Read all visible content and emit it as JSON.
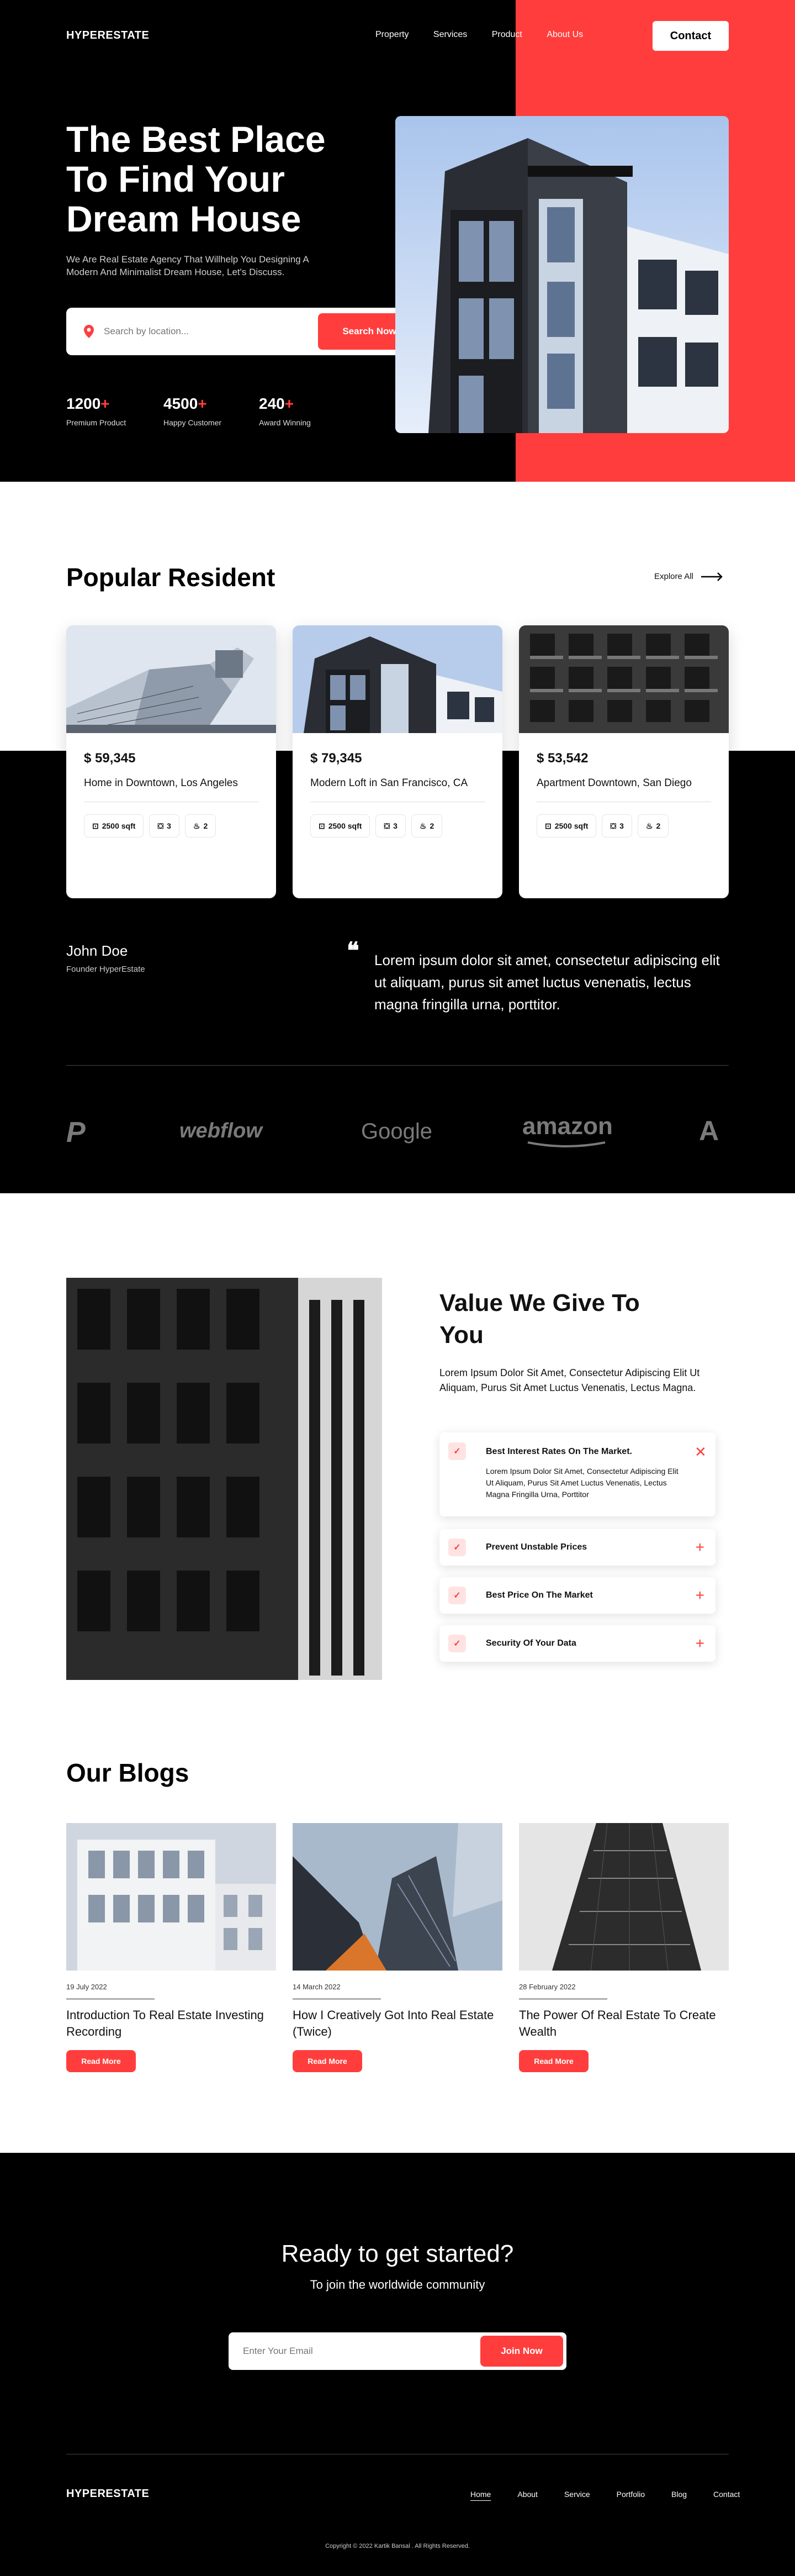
{
  "header": {
    "logo": "HYPERESTATE",
    "nav": [
      "Property",
      "Services",
      "Product",
      "About Us"
    ],
    "contact": "Contact"
  },
  "hero": {
    "title": "The Best Place To Find Your Dream House",
    "subtitle": "We Are  Real Estate Agency That Willhelp You Designing A Modern And Minimalist Dream House, Let's Discuss.",
    "search_placeholder": "Search by location...",
    "search_button": "Search Now",
    "stats": [
      {
        "value": "1200",
        "suffix": "+",
        "label": "Premium Product"
      },
      {
        "value": "4500",
        "suffix": "+",
        "label": "Happy Customer"
      },
      {
        "value": "240",
        "suffix": "+",
        "label": "Award Winning"
      }
    ]
  },
  "popular": {
    "title": "Popular Resident",
    "explore": "Explore All",
    "cards": [
      {
        "price": "$ 59,345",
        "name": "Home in Downtown, Los Angeles",
        "sqft": "2500 sqft",
        "beds": "3",
        "baths": "2"
      },
      {
        "price": "$ 79,345",
        "name": "Modern Loft in San Francisco, CA",
        "sqft": "2500 sqft",
        "beds": "3",
        "baths": "2"
      },
      {
        "price": "$ 53,542",
        "name": "Apartment Downtown, San Diego",
        "sqft": "2500 sqft",
        "beds": "3",
        "baths": "2"
      }
    ]
  },
  "testimonial": {
    "name": "John Doe",
    "role": "Founder HyperEstate",
    "quote": "Lorem ipsum dolor sit amet, consectetur adipiscing elit ut aliquam, purus sit amet luctus venenatis, lectus magna fringilla urna, porttitor."
  },
  "brands": [
    "P",
    "webflow",
    "Google",
    "amazon",
    "A"
  ],
  "value": {
    "title": "Value We Give To You",
    "desc": "Lorem Ipsum Dolor Sit Amet, Consectetur Adipiscing Elit Ut Aliquam, Purus Sit Amet Luctus Venenatis, Lectus Magna.",
    "items": [
      {
        "title": "Best Interest Rates On The Market.",
        "body": "Lorem Ipsum Dolor Sit Amet, Consectetur Adipiscing Elit Ut Aliquam, Purus Sit Amet Luctus Venenatis, Lectus Magna Fringilla Urna, Porttitor",
        "open": true
      },
      {
        "title": "Prevent Unstable Prices",
        "open": false
      },
      {
        "title": "Best Price On The Market",
        "open": false
      },
      {
        "title": "Security Of Your Data",
        "open": false
      }
    ]
  },
  "blogs": {
    "title": "Our Blogs",
    "read_more": "Read More",
    "posts": [
      {
        "date": "19 July 2022",
        "title": "Introduction To Real Estate Investing Recording"
      },
      {
        "date": "14 March 2022",
        "title": "How I Creatively Got Into Real Estate (Twice)"
      },
      {
        "date": "28 February 2022",
        "title": "The Power Of Real Estate To Create Wealth"
      }
    ]
  },
  "cta": {
    "title": "Ready to get started?",
    "subtitle": "To join the worldwide community",
    "email_placeholder": "Enter Your Email",
    "button": "Join Now"
  },
  "footer": {
    "logo": "HYPERESTATE",
    "nav": [
      "Home",
      "About",
      "Service",
      "Portfolio",
      "Blog",
      "Contact"
    ],
    "copyright": "Copyright © 2022 Kartik Bansal . All Rights Reserved."
  },
  "colors": {
    "accent": "#ff3d3d",
    "dark": "#000000"
  }
}
